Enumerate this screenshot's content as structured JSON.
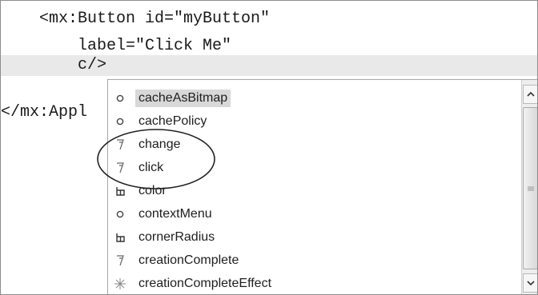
{
  "editor": {
    "lines": [
      "    <mx:Button id=\"myButton\"",
      "        label=\"Click Me\"",
      "        c/>",
      "",
      "</mx:Appl"
    ]
  },
  "autocomplete": {
    "items": [
      {
        "label": "cacheAsBitmap",
        "icon": "property-icon"
      },
      {
        "label": "cachePolicy",
        "icon": "property-icon"
      },
      {
        "label": "change",
        "icon": "event-icon"
      },
      {
        "label": "click",
        "icon": "event-icon"
      },
      {
        "label": "color",
        "icon": "style-icon"
      },
      {
        "label": "contextMenu",
        "icon": "property-icon"
      },
      {
        "label": "cornerRadius",
        "icon": "style-icon"
      },
      {
        "label": "creationComplete",
        "icon": "event-icon"
      },
      {
        "label": "creationCompleteEffect",
        "icon": "effect-icon"
      }
    ],
    "selected_index": 0
  },
  "colors": {
    "selection": "#d8d8d8",
    "current_line": "#e9e9e9",
    "annotation": "#222222"
  }
}
